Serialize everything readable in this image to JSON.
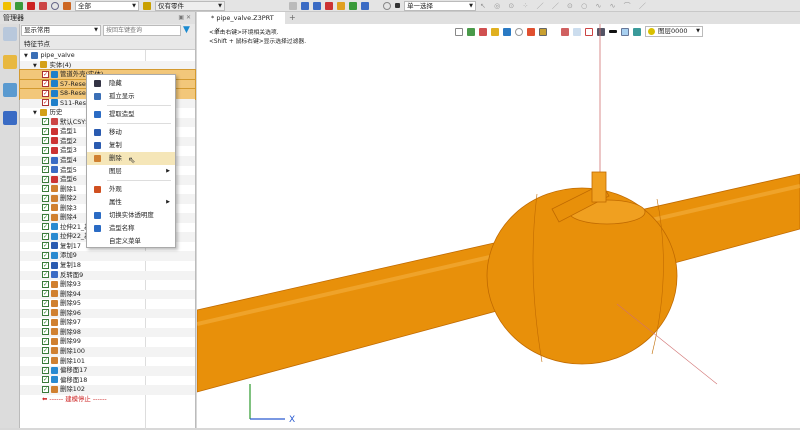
{
  "toolbar": {
    "filter_all": "全部",
    "filter_parts": "仅有零件",
    "select_mode": "单一选择"
  },
  "manager": {
    "title": "管理器",
    "display_combo": "显示常用",
    "search_placeholder": "按回车键查询",
    "column_header": "特征节点"
  },
  "tree": [
    {
      "label": "pipe_valve",
      "indent": 0,
      "expander": true,
      "check": false,
      "icon": "assembly-icon",
      "color": "#3b6fb6"
    },
    {
      "label": "实体(4)",
      "indent": 1,
      "expander": true,
      "check": false,
      "icon": "solids-folder-icon",
      "color": "#d4a017"
    },
    {
      "label": "管道外壳(实体)",
      "indent": 2,
      "check": "red",
      "icon": "solid-icon",
      "color": "#1f7fc9",
      "selected": true
    },
    {
      "label": "S7-Reser",
      "indent": 2,
      "check": "red",
      "icon": "solid-icon",
      "color": "#1f7fc9",
      "selected": true
    },
    {
      "label": "S8-Reser",
      "indent": 2,
      "check": "red",
      "icon": "solid-icon",
      "color": "#1f7fc9",
      "selected": true
    },
    {
      "label": "S11-Rese",
      "indent": 2,
      "check": "red",
      "icon": "solid-icon",
      "color": "#1f7fc9"
    },
    {
      "label": "历史",
      "indent": 1,
      "expander": true,
      "check": false,
      "icon": "history-folder-icon",
      "color": "#d4a017"
    },
    {
      "label": "默认CSYS",
      "indent": 2,
      "check": "green",
      "icon": "csys-icon",
      "color": "#c44"
    },
    {
      "label": "造型1",
      "indent": 2,
      "check": "green",
      "icon": "shape-icon",
      "color": "#c33"
    },
    {
      "label": "造型2",
      "indent": 2,
      "check": "green",
      "icon": "shape-icon",
      "color": "#c33"
    },
    {
      "label": "造型3",
      "indent": 2,
      "check": "green",
      "icon": "shape-icon",
      "color": "#c33"
    },
    {
      "label": "造型4",
      "indent": 2,
      "check": "green",
      "icon": "shape-icon",
      "color": "#3a6bc4"
    },
    {
      "label": "造型5",
      "indent": 2,
      "check": "green",
      "icon": "shape-icon",
      "color": "#3a6bc4"
    },
    {
      "label": "造型6",
      "indent": 2,
      "check": "green",
      "icon": "shape-icon",
      "color": "#c33"
    },
    {
      "label": "删除1",
      "indent": 2,
      "check": "green",
      "icon": "delete-icon",
      "color": "#d08030"
    },
    {
      "label": "删除2",
      "indent": 2,
      "check": "green",
      "icon": "delete-icon",
      "color": "#d08030"
    },
    {
      "label": "删除3",
      "indent": 2,
      "check": "green",
      "icon": "delete-icon",
      "color": "#d08030"
    },
    {
      "label": "删除4",
      "indent": 2,
      "check": "green",
      "icon": "delete-icon",
      "color": "#d08030"
    },
    {
      "label": "拉伸21_基",
      "indent": 2,
      "check": "green",
      "icon": "extrude-icon",
      "color": "#2a8ad0"
    },
    {
      "label": "拉伸22_基",
      "indent": 2,
      "check": "green",
      "icon": "extrude-icon",
      "color": "#2a8ad0"
    },
    {
      "label": "复制17",
      "indent": 2,
      "check": "green",
      "icon": "copy-icon",
      "color": "#2a5bb0"
    },
    {
      "label": "添加9",
      "indent": 2,
      "check": "green",
      "icon": "add-icon",
      "color": "#2a8ad0"
    },
    {
      "label": "复制18",
      "indent": 2,
      "check": "green",
      "icon": "copy-icon",
      "color": "#2a5bb0"
    },
    {
      "label": "反转面9",
      "indent": 2,
      "check": "green",
      "icon": "reverse-face-icon",
      "color": "#3a6bc4"
    },
    {
      "label": "删除93",
      "indent": 2,
      "check": "green",
      "icon": "delete-icon",
      "color": "#d08030"
    },
    {
      "label": "删除94",
      "indent": 2,
      "check": "green",
      "icon": "delete-icon",
      "color": "#d08030"
    },
    {
      "label": "删除95",
      "indent": 2,
      "check": "green",
      "icon": "delete-icon",
      "color": "#d08030"
    },
    {
      "label": "删除96",
      "indent": 2,
      "check": "green",
      "icon": "delete-icon",
      "color": "#d08030"
    },
    {
      "label": "删除97",
      "indent": 2,
      "check": "green",
      "icon": "delete-icon",
      "color": "#d08030"
    },
    {
      "label": "删除98",
      "indent": 2,
      "check": "green",
      "icon": "delete-icon",
      "color": "#d08030"
    },
    {
      "label": "删除99",
      "indent": 2,
      "check": "green",
      "icon": "delete-icon",
      "color": "#d08030"
    },
    {
      "label": "删除100",
      "indent": 2,
      "check": "green",
      "icon": "delete-icon",
      "color": "#d08030"
    },
    {
      "label": "删除101",
      "indent": 2,
      "check": "green",
      "icon": "delete-icon",
      "color": "#d08030"
    },
    {
      "label": "偏移面17",
      "indent": 2,
      "check": "green",
      "icon": "offset-face-icon",
      "color": "#2a8ad0"
    },
    {
      "label": "偏移面18",
      "indent": 2,
      "check": "green",
      "icon": "offset-face-icon",
      "color": "#2a8ad0"
    },
    {
      "label": "删除102",
      "indent": 2,
      "check": "green",
      "icon": "delete-icon",
      "color": "#d08030"
    }
  ],
  "rollback_marker": "------ 建模停止 ------",
  "context_menu": [
    {
      "label": "隐藏",
      "icon": "hide-icon",
      "color": "#334"
    },
    {
      "label": "孤立显示",
      "icon": "isolate-icon",
      "color": "#3b6fb6"
    },
    {
      "sep": true
    },
    {
      "label": "提取造型",
      "icon": "extract-shape-icon",
      "color": "#2a6bc4"
    },
    {
      "sep": true
    },
    {
      "label": "移动",
      "icon": "move-icon",
      "color": "#2a5bb0"
    },
    {
      "label": "复制",
      "icon": "copy-icon",
      "color": "#2a5bb0"
    },
    {
      "label": "删除",
      "icon": "delete-icon",
      "color": "#d08030",
      "highlighted": true
    },
    {
      "label": "图层",
      "icon": "",
      "submenu": true
    },
    {
      "sep": true
    },
    {
      "label": "外观",
      "icon": "appearance-icon",
      "color": "#d05020"
    },
    {
      "label": "属性",
      "icon": "",
      "submenu": true
    },
    {
      "label": "切换实体透明度",
      "icon": "transparency-icon",
      "color": "#2a6bc4"
    },
    {
      "label": "造型名称",
      "icon": "shape-name-icon",
      "color": "#2a6bc4"
    },
    {
      "label": "自定义菜单",
      "icon": ""
    }
  ],
  "viewport": {
    "tab_label": "* pipe_valve.Z3PRT",
    "hint1": "<单击右键>环境相关选项.",
    "hint2": "<Shift + 鼠标右键>显示选择过滤器.",
    "layer_combo": "图层0000",
    "axis_x": "X",
    "model_color": "#e8900a"
  }
}
